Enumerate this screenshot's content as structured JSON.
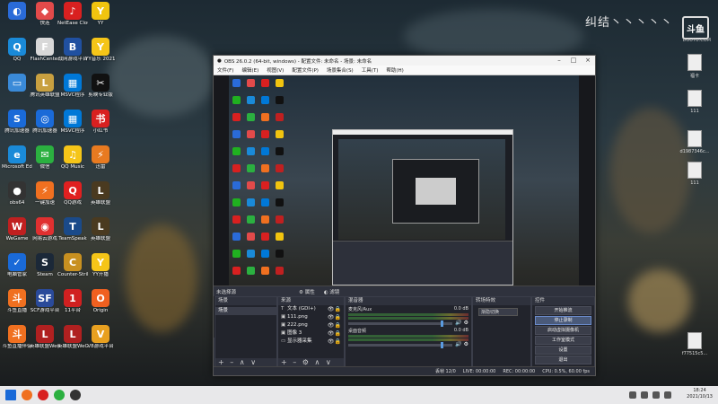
{
  "colors": {
    "accent": "#5a9be0",
    "obs_bg": "#2b2e38",
    "taskbar": "#e8e8ea"
  },
  "watermark": {
    "text": "纠结丶丶丶丶丶",
    "logo": "斗鱼",
    "domain": "DOUYU.COM"
  },
  "desktop_icons": [
    {
      "label": "",
      "color": "#2a6bd8",
      "glyph": "◐"
    },
    {
      "label": "快连",
      "color": "#e24a4a",
      "glyph": "◆"
    },
    {
      "label": "NetEase CloudMusic",
      "color": "#d92020",
      "glyph": "♪"
    },
    {
      "label": "YY",
      "color": "#f1c40f",
      "glyph": "Y"
    },
    {
      "label": "爱奇艺",
      "color": "#20b020",
      "glyph": "i"
    },
    {
      "label": "QQ",
      "color": "#1a8ad8",
      "glyph": "Q"
    },
    {
      "label": "FlashCenter",
      "color": "#d8d8d8",
      "glyph": "F"
    },
    {
      "label": "战网游戏平台",
      "color": "#2050a0",
      "glyph": "B"
    },
    {
      "label": "YY音乐 20211012",
      "color": "#f5c518",
      "glyph": "Y"
    },
    {
      "label": "",
      "color": "#000",
      "glyph": ""
    },
    {
      "label": "",
      "color": "#3a8ad8",
      "glyph": "▭"
    },
    {
      "label": "腾讯英雄联盟",
      "color": "#c8a040",
      "glyph": "L"
    },
    {
      "label": "MSVC程序",
      "color": "#0078d7",
      "glyph": "▦"
    },
    {
      "label": "剪映专业版",
      "color": "#111",
      "glyph": "✂"
    },
    {
      "label": "",
      "color": "#000",
      "glyph": ""
    },
    {
      "label": "腾讯加速器",
      "color": "#1a6ad8",
      "glyph": "S"
    },
    {
      "label": "腾讯加速器",
      "color": "#1a6ad8",
      "glyph": "◎"
    },
    {
      "label": "MSVC程序",
      "color": "#0078d7",
      "glyph": "▦"
    },
    {
      "label": "小红书",
      "color": "#d82020",
      "glyph": "书"
    },
    {
      "label": "",
      "color": "#000",
      "glyph": ""
    },
    {
      "label": "Microsoft Edge",
      "color": "#1a8ad8",
      "glyph": "e"
    },
    {
      "label": "微信",
      "color": "#2bb040",
      "glyph": "✉"
    },
    {
      "label": "QQ Music",
      "color": "#f5c518",
      "glyph": "♫"
    },
    {
      "label": "迅雷",
      "color": "#e87a20",
      "glyph": "⚡"
    },
    {
      "label": "",
      "color": "#000",
      "glyph": ""
    },
    {
      "label": "obs64",
      "color": "#333",
      "glyph": "●"
    },
    {
      "label": "一键加速",
      "color": "#f07020",
      "glyph": "⚡"
    },
    {
      "label": "QQ游戏",
      "color": "#e02020",
      "glyph": "Q"
    },
    {
      "label": "英雄联盟",
      "color": "#4a3a20",
      "glyph": "L"
    },
    {
      "label": "",
      "color": "#000",
      "glyph": ""
    },
    {
      "label": "WeGame",
      "color": "#c02020",
      "glyph": "W"
    },
    {
      "label": "网易云游戏",
      "color": "#e03030",
      "glyph": "◉"
    },
    {
      "label": "TeamSpeak",
      "color": "#1a4a8a",
      "glyph": "T"
    },
    {
      "label": "英雄联盟",
      "color": "#4a3a20",
      "glyph": "L"
    },
    {
      "label": "",
      "color": "#000",
      "glyph": ""
    },
    {
      "label": "电脑管家",
      "color": "#1a6ad8",
      "glyph": "✓"
    },
    {
      "label": "Steam",
      "color": "#1b2838",
      "glyph": "S"
    },
    {
      "label": "Counter-Strike",
      "color": "#c89020",
      "glyph": "C"
    },
    {
      "label": "YY开播",
      "color": "#f5c518",
      "glyph": "Y"
    },
    {
      "label": "",
      "color": "#000",
      "glyph": ""
    },
    {
      "label": "斗鱼直播",
      "color": "#f07020",
      "glyph": "斗"
    },
    {
      "label": "SCF游戏平台",
      "color": "#2a4a9a",
      "glyph": "SF"
    },
    {
      "label": "11平台",
      "color": "#d02020",
      "glyph": "1"
    },
    {
      "label": "Origin",
      "color": "#f06020",
      "glyph": "O"
    },
    {
      "label": "",
      "color": "#000",
      "glyph": ""
    },
    {
      "label": "斗鱼直播伴侣",
      "color": "#f07020",
      "glyph": "斗"
    },
    {
      "label": "英雄联盟WeGame",
      "color": "#b02020",
      "glyph": "L"
    },
    {
      "label": "英雄联盟WeGame",
      "color": "#b02020",
      "glyph": "L"
    },
    {
      "label": "V8游戏平台",
      "color": "#e8a020",
      "glyph": "V"
    },
    {
      "label": "",
      "color": "#000",
      "glyph": ""
    }
  ],
  "right_icons": [
    {
      "label": "福卡"
    },
    {
      "label": "111"
    },
    {
      "label": "d1987346c..."
    },
    {
      "label": "111"
    },
    {
      "label": "f77515c5..."
    }
  ],
  "obs": {
    "title": "OBS 26.0.2 (64-bit, windows) - 配置文件: 未命名 - 场景: 未命名",
    "menu": [
      "文件(F)",
      "编辑(E)",
      "视图(V)",
      "配置文件(P)",
      "场景集合(S)",
      "工具(T)",
      "帮助(H)"
    ],
    "toolbar": {
      "source_label": "未选择源",
      "props": "属性",
      "filters": "滤镜"
    },
    "scenes": {
      "header": "场景",
      "items": [
        "场景"
      ],
      "tab": "场景"
    },
    "sources": {
      "header": "来源",
      "items": [
        {
          "icon": "T",
          "name": "文本 (GDI+)"
        },
        {
          "icon": "▣",
          "name": "111.png"
        },
        {
          "icon": "▣",
          "name": "222.png"
        },
        {
          "icon": "▣",
          "name": "图像 3"
        },
        {
          "icon": "▭",
          "name": "显示器采集"
        }
      ]
    },
    "mixer": {
      "header": "混音器",
      "tracks": [
        {
          "name": "麦克风/Aux",
          "db": "0.0 dB"
        },
        {
          "name": "桌面音频",
          "db": "0.0 dB"
        }
      ]
    },
    "transitions": {
      "header": "转场特效",
      "value": "渐隐切换"
    },
    "controls": {
      "header": "控件",
      "buttons": [
        "开始推流",
        "停止录制",
        "启动虚拟摄像机",
        "工作室模式",
        "设置",
        "退出"
      ]
    },
    "status": {
      "live": "LIVE: 00:00:00",
      "rec": "REC: 00:00:00",
      "cpu": "CPU: 0.5%, 60.00 fps",
      "dropped": "丢帧 12/0"
    }
  },
  "taskbar": {
    "time": "18:24",
    "date": "2021/10/13"
  }
}
